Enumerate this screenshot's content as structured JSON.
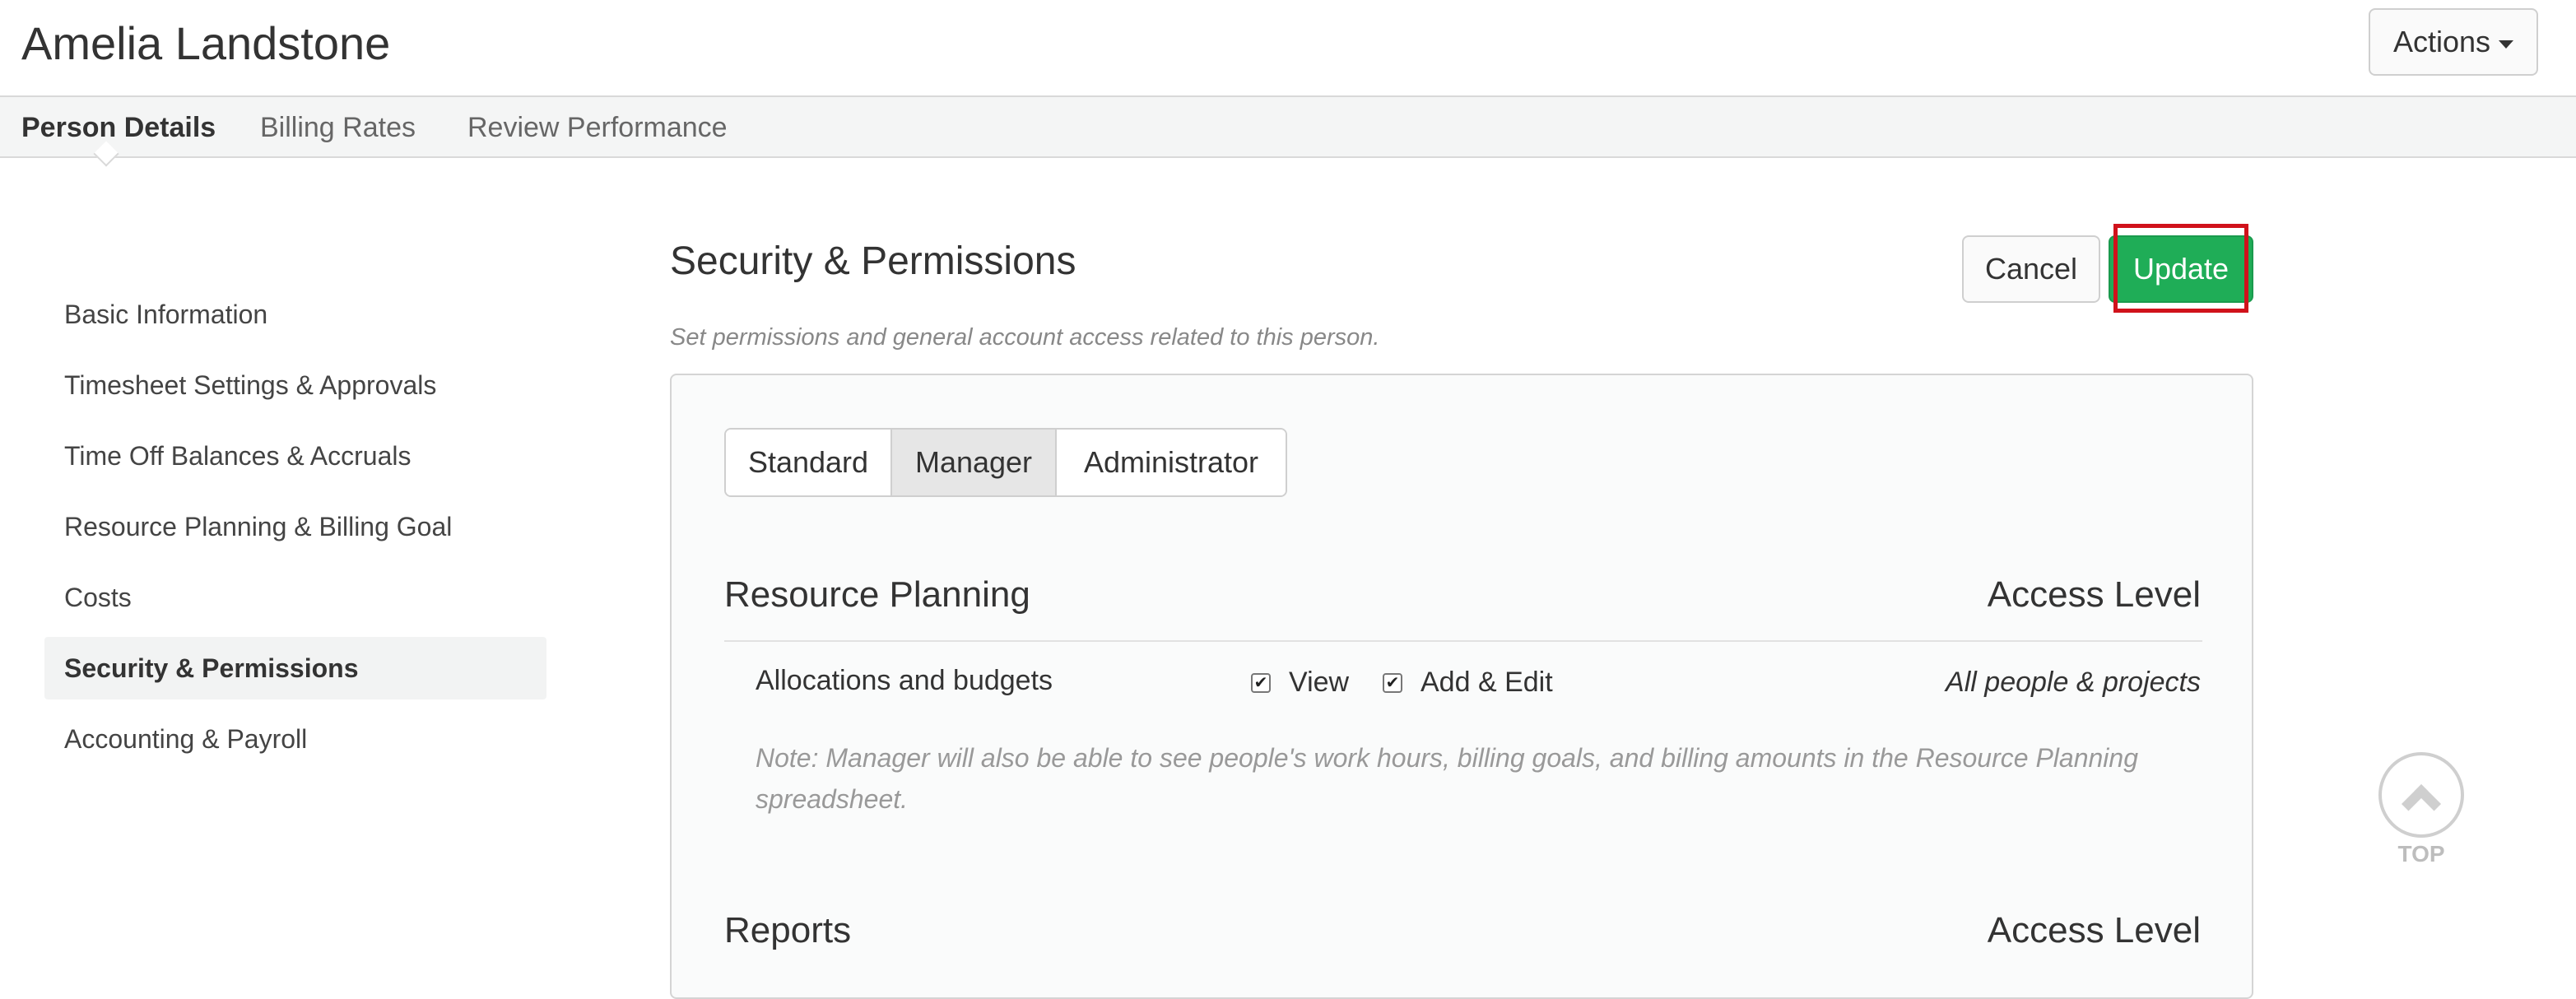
{
  "header": {
    "person_name": "Amelia Landstone",
    "actions_label": "Actions"
  },
  "tabs": [
    {
      "label": "Person Details",
      "active": true
    },
    {
      "label": "Billing Rates",
      "active": false
    },
    {
      "label": "Review Performance",
      "active": false
    }
  ],
  "sidenav": {
    "items": [
      {
        "label": "Basic Information",
        "active": false
      },
      {
        "label": "Timesheet Settings & Approvals",
        "active": false
      },
      {
        "label": "Time Off Balances & Accruals",
        "active": false
      },
      {
        "label": "Resource Planning & Billing Goal",
        "active": false
      },
      {
        "label": "Costs",
        "active": false
      },
      {
        "label": "Security & Permissions",
        "active": true
      },
      {
        "label": "Accounting & Payroll",
        "active": false
      }
    ]
  },
  "main": {
    "title": "Security & Permissions",
    "subtitle": "Set permissions and general account access related to this person.",
    "cancel_label": "Cancel",
    "update_label": "Update",
    "role_options": [
      "Standard",
      "Manager",
      "Administrator"
    ],
    "selected_role": "Manager",
    "resource_planning": {
      "heading": "Resource Planning",
      "access_heading": "Access Level",
      "permission_label": "Allocations and budgets",
      "view_label": "View",
      "view_checked": true,
      "add_edit_label": "Add & Edit",
      "add_edit_checked": true,
      "scope": "All people & projects",
      "note": "Note: Manager will also be able to see people's work hours, billing goals, and billing amounts in the Resource Planning spreadsheet."
    },
    "reports": {
      "heading": "Reports",
      "access_heading": "Access Level"
    }
  },
  "top_button_label": "TOP",
  "colors": {
    "update_green": "#1fad57",
    "highlight_red": "#d0121b"
  },
  "icons": {
    "actions_caret": "caret-down-icon",
    "checkbox": "checkmark-icon",
    "top": "chevron-up-icon"
  }
}
